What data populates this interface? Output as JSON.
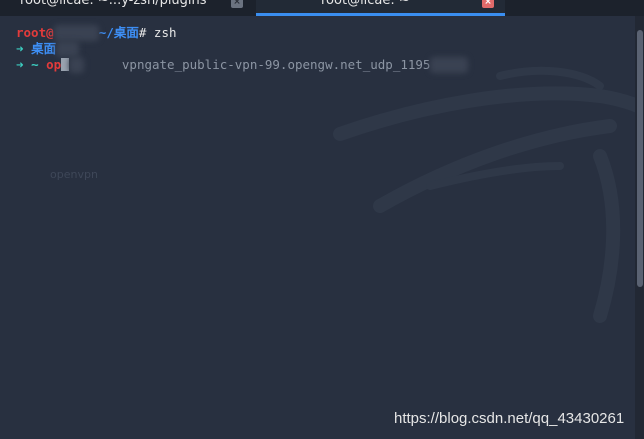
{
  "tabs": [
    {
      "title": "root@licae: ~...y-zsh/plugins",
      "close_label": "×",
      "active": false
    },
    {
      "title": "root@licae: ~",
      "close_label": "×",
      "active": true
    }
  ],
  "terminal": {
    "line1": {
      "user": "root@",
      "path": "~/桌面",
      "prompt_char": "#",
      "command": "zsh"
    },
    "line2": {
      "arrow": "➜",
      "dir": "桌面",
      "rest": "git"
    },
    "line3": {
      "arrow": "➜",
      "dir": "~",
      "typed_a": "op",
      "typed_b": "en",
      "suggestion": "vpngate_public-vpn-99.opengw.net_udp_1195"
    },
    "ghost_text": "openvpn"
  },
  "watermark": "https://blog.csdn.net/qq_43430261",
  "colors": {
    "background": "#283040",
    "accent": "#3a8ef0",
    "prompt_red": "#e33b3b",
    "path_blue": "#3d8ef4",
    "arrow_cyan": "#3ccdc0"
  }
}
